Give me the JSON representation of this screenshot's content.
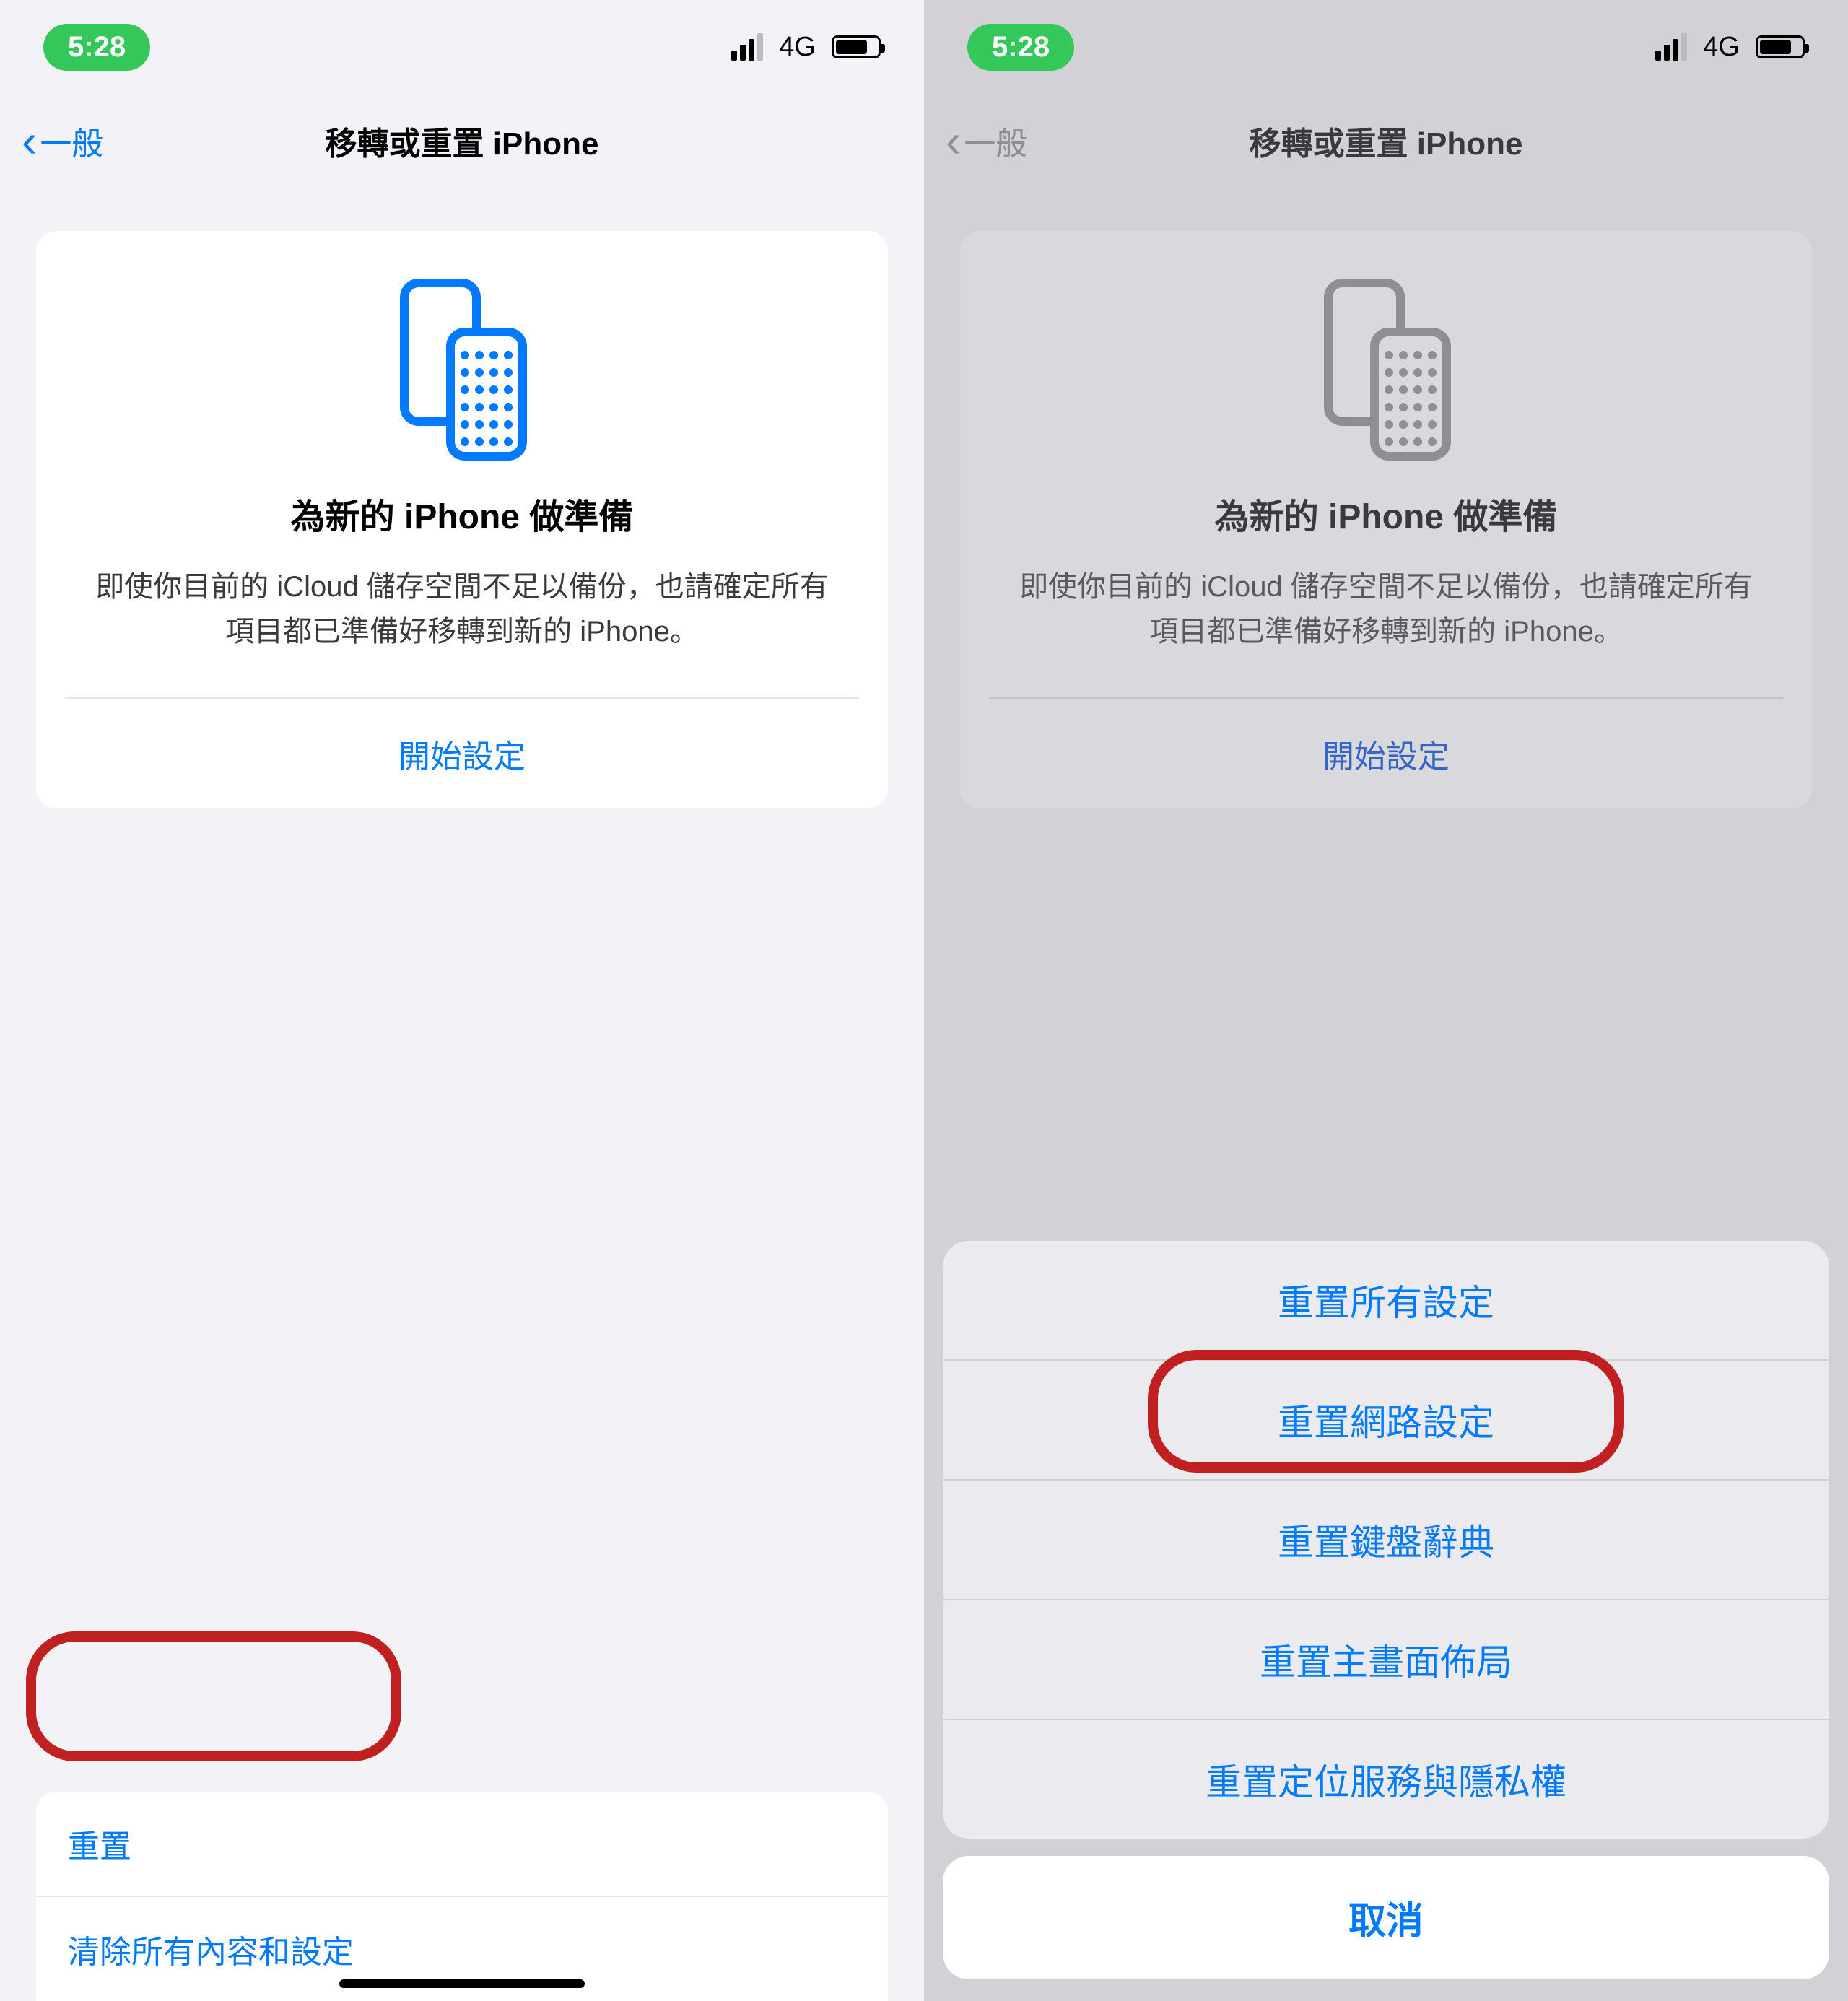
{
  "status": {
    "time": "5:28",
    "network": "4G"
  },
  "nav": {
    "back_label": "一般",
    "title": "移轉或重置 iPhone"
  },
  "card": {
    "title": "為新的 iPhone 做準備",
    "desc": "即使你目前的 iCloud 儲存空間不足以備份，也請確定所有項目都已準備好移轉到新的 iPhone。",
    "action": "開始設定"
  },
  "bottom": {
    "reset": "重置",
    "erase": "清除所有內容和設定"
  },
  "sheet": {
    "options": [
      "重置所有設定",
      "重置網路設定",
      "重置鍵盤辭典",
      "重置主畫面佈局",
      "重置定位服務與隱私權"
    ],
    "cancel": "取消"
  },
  "colors": {
    "tint": "#007aff",
    "green": "#34c759",
    "annotation": "#c0201f"
  }
}
